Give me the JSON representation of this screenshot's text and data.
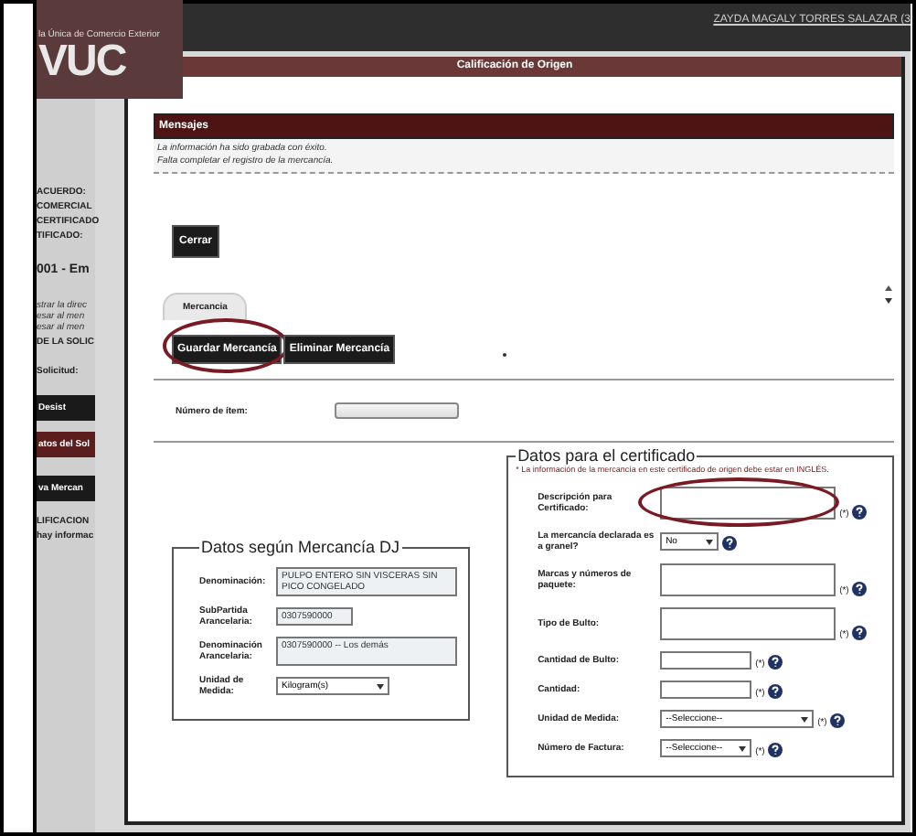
{
  "background": {
    "portal_name": "la Única de Comercio Exterior",
    "logo": "VUC",
    "user_link": "ZAYDA MAGALY TORRES SALAZAR (3",
    "side_texts": [
      {
        "text": "ACUERDO:",
        "kind": "label"
      },
      {
        "text": "COMERCIAL",
        "kind": "label"
      },
      {
        "text": "CERTIFICADO",
        "kind": "label"
      },
      {
        "text": "TIFICADO:",
        "kind": "label"
      },
      {
        "text": "001 - Em",
        "kind": "heading"
      },
      {
        "text": "strar la direc",
        "kind": "link"
      },
      {
        "text": "esar al men",
        "kind": "link"
      },
      {
        "text": "esar al men",
        "kind": "link"
      },
      {
        "text": "DE LA SOLIC",
        "kind": "label"
      },
      {
        "text": "Solicitud:",
        "kind": "label"
      },
      {
        "text": "Desist",
        "kind": "button"
      },
      {
        "text": "atos del Sol",
        "kind": "band"
      },
      {
        "text": "va Mercan",
        "kind": "button"
      },
      {
        "text": "LIFICACION",
        "kind": "label"
      },
      {
        "text": "hay informac",
        "kind": "label"
      }
    ]
  },
  "modal": {
    "title": "Calificación de Origen",
    "messages": {
      "title": "Mensajes",
      "lines": [
        "La información ha sido grabada con éxito.",
        "Falta completar el registro de la mercancía."
      ]
    },
    "close_button": "Cerrar",
    "tabs": [
      {
        "label": "Mercancia",
        "selected": true
      }
    ],
    "action_buttons": [
      {
        "label": "Guardar Mercancía",
        "highlighted": true
      },
      {
        "label": "Eliminar Mercancía",
        "highlighted": false
      }
    ],
    "item_number": {
      "label": "Número de ítem:"
    },
    "dj": {
      "legend": "Datos según Mercancía DJ",
      "fields": [
        {
          "label": "Denominación:",
          "kind": "textarea",
          "value": "PULPO ENTERO SIN VISCERAS SIN PICO CONGELADO"
        },
        {
          "label": "SubPartida Arancelaria:",
          "kind": "input",
          "value": "0307590000"
        },
        {
          "label": "Denominación Arancelaria:",
          "kind": "textarea",
          "value": "0307590000 -- Los demás"
        },
        {
          "label": "Unidad de Medida:",
          "kind": "select",
          "value": "Kilogram(s)"
        }
      ]
    },
    "certificate": {
      "legend": "Datos para el certificado",
      "note": "* La información de la mercancía en este certificado de origen debe estar en INGLÉS.",
      "fields": [
        {
          "label": "Descripción para Certificado:",
          "kind": "textarea",
          "required_mark": "(*)",
          "highlighted": true
        },
        {
          "label": "La mercancía declarada es a granel?",
          "kind": "select",
          "value": "No",
          "highlighted": false
        },
        {
          "label": "Marcas y números de paquete:",
          "kind": "textarea",
          "required_mark": "(*)",
          "highlighted": false
        },
        {
          "label": "Tipo de Bulto:",
          "kind": "textarea",
          "required_mark": "(*)",
          "highlighted": false
        },
        {
          "label": "Cantidad de Bulto:",
          "kind": "input",
          "required_mark": "(*)",
          "highlighted": false
        },
        {
          "label": "Cantidad:",
          "kind": "input",
          "required_mark": "(*)",
          "highlighted": false
        },
        {
          "label": "Unidad de Medida:",
          "kind": "select",
          "value": "--Seleccione--",
          "required_mark": "(*)",
          "highlighted": false
        },
        {
          "label": "Número de Factura:",
          "kind": "smallselect",
          "value": "--Seleccione--",
          "required_mark": "(*)",
          "highlighted": false
        }
      ]
    }
  }
}
